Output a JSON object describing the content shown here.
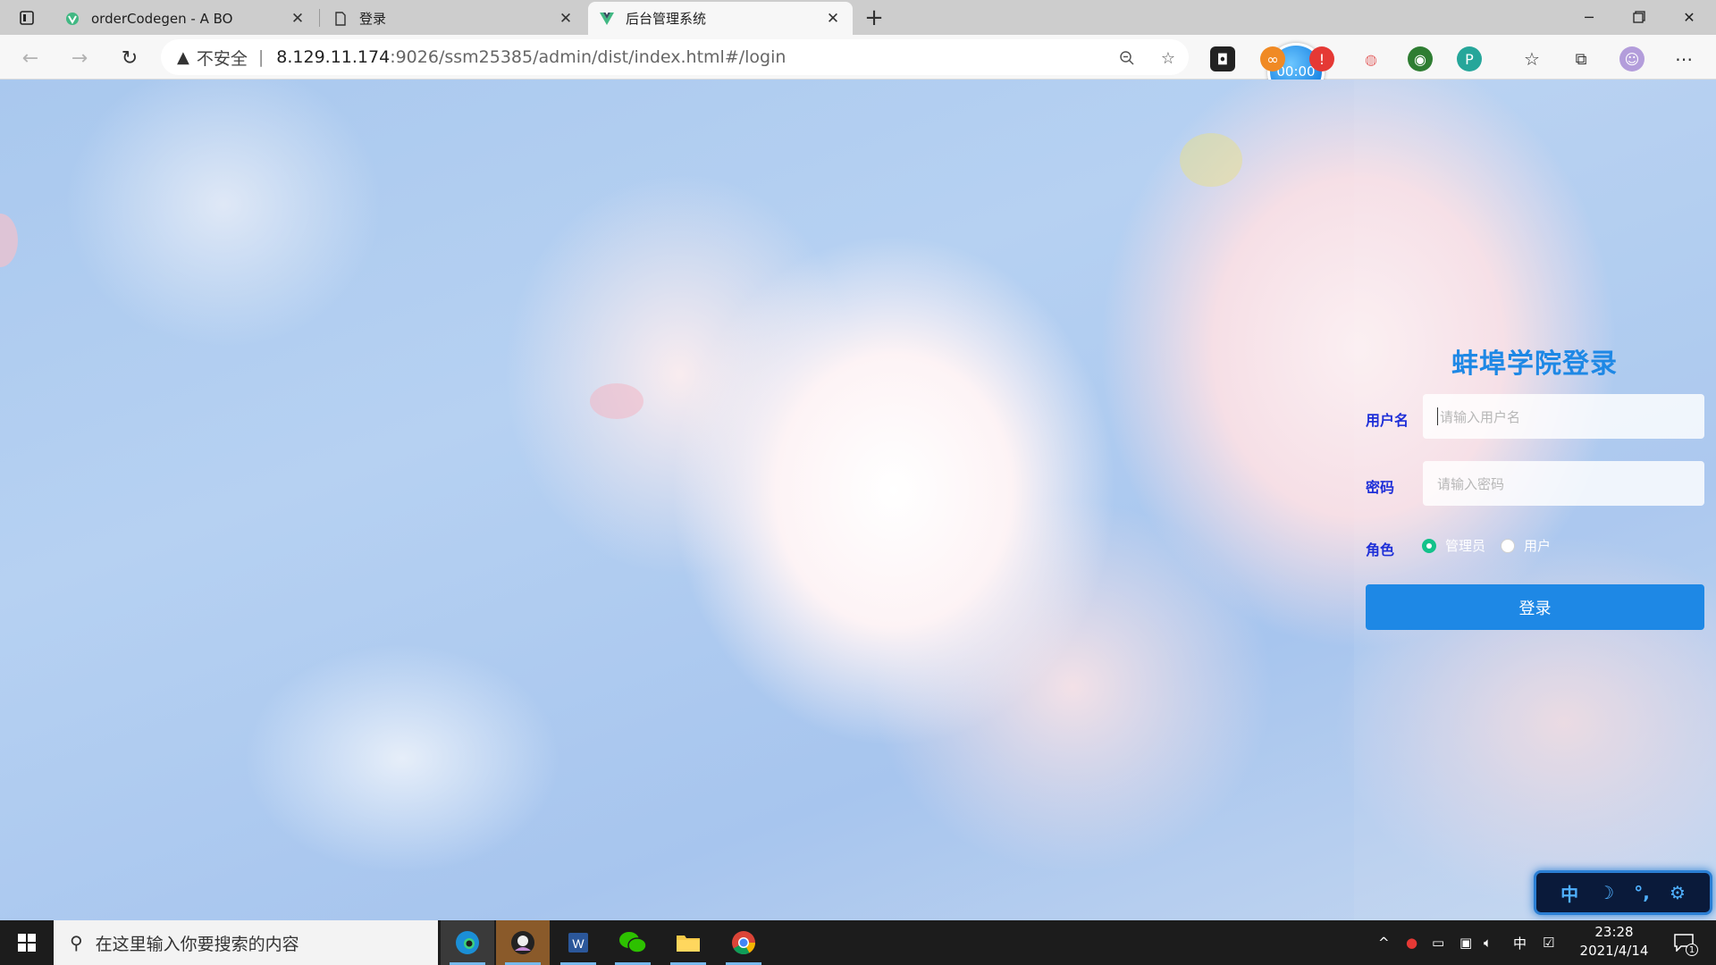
{
  "browser": {
    "tabs": [
      {
        "title": "orderCodegen - A BO",
        "state": "inactive",
        "icon": "vue-icon"
      },
      {
        "title": "登录",
        "state": "inactive",
        "icon": "page-icon"
      },
      {
        "title": "后台管理系统",
        "state": "active",
        "icon": "vue-icon"
      }
    ],
    "address": {
      "security_label": "不安全",
      "host": "8.129.11.174",
      "path": ":9026/ssm25385/admin/dist/index.html#/login"
    },
    "timer": "00:00"
  },
  "login": {
    "title": "蚌埠学院登录",
    "username_label": "用户名",
    "username_placeholder": "请输入用户名",
    "password_label": "密码",
    "password_placeholder": "请输入密码",
    "role_label": "角色",
    "roles": [
      {
        "label": "管理员",
        "checked": true
      },
      {
        "label": "用户",
        "checked": false
      }
    ],
    "submit_label": "登录"
  },
  "ime": {
    "items": [
      "中",
      "☽",
      "°,",
      "⚙"
    ]
  },
  "taskbar": {
    "search_placeholder": "在这里输入你要搜索的内容",
    "apps": [
      "edge-icon",
      "mascot-icon",
      "word-icon",
      "wechat-icon",
      "file-explorer-icon",
      "chrome-icon"
    ],
    "tray_lang": "中",
    "time": "23:28",
    "date": "2021/4/14",
    "notification_count": "1"
  },
  "colors": {
    "accent": "#1e88e5",
    "label": "#1e2fd8",
    "radio_checked": "#13c28a"
  }
}
